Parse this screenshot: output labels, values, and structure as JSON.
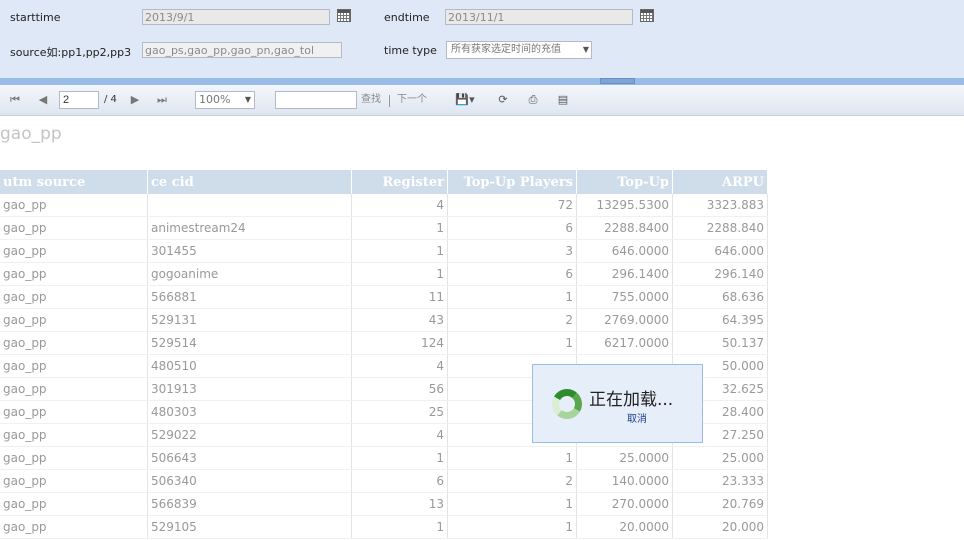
{
  "params": {
    "starttime_label": "starttime",
    "starttime_value": "2013/9/1",
    "endtime_label": "endtime",
    "endtime_value": "2013/11/1",
    "source_label": "source如:pp1,pp2,pp3",
    "source_value": "gao_ps,gao_pp,gao_pn,gao_tol",
    "timetype_label": "time type",
    "timetype_value": "所有获家选定时间的充值"
  },
  "toolbar": {
    "page_value": "2",
    "page_total": "/ 4",
    "zoom_value": "100%",
    "find_label": "查找",
    "next_label": "下一个"
  },
  "report": {
    "title": "gao_pp",
    "columns": [
      "utm source",
      "ce cid",
      "Register",
      "Top-Up Players",
      "Top-Up",
      "ARPU"
    ],
    "rows": [
      [
        "gao_pp",
        "",
        "4",
        "72",
        "13295.5300",
        "3323.883"
      ],
      [
        "gao_pp",
        "animestream24",
        "1",
        "6",
        "2288.8400",
        "2288.840"
      ],
      [
        "gao_pp",
        "301455",
        "1",
        "3",
        "646.0000",
        "646.000"
      ],
      [
        "gao_pp",
        "gogoanime",
        "1",
        "6",
        "296.1400",
        "296.140"
      ],
      [
        "gao_pp",
        "566881",
        "11",
        "1",
        "755.0000",
        "68.636"
      ],
      [
        "gao_pp",
        "529131",
        "43",
        "2",
        "2769.0000",
        "64.395"
      ],
      [
        "gao_pp",
        "529514",
        "124",
        "1",
        "6217.0000",
        "50.137"
      ],
      [
        "gao_pp",
        "480510",
        "4",
        "",
        "",
        "50.000"
      ],
      [
        "gao_pp",
        "301913",
        "56",
        "",
        "",
        "32.625"
      ],
      [
        "gao_pp",
        "480303",
        "25",
        "",
        "",
        "28.400"
      ],
      [
        "gao_pp",
        "529022",
        "4",
        "",
        "",
        "27.250"
      ],
      [
        "gao_pp",
        "506643",
        "1",
        "1",
        "25.0000",
        "25.000"
      ],
      [
        "gao_pp",
        "506340",
        "6",
        "2",
        "140.0000",
        "23.333"
      ],
      [
        "gao_pp",
        "566839",
        "13",
        "1",
        "270.0000",
        "20.769"
      ],
      [
        "gao_pp",
        "529105",
        "1",
        "1",
        "20.0000",
        "20.000"
      ]
    ]
  },
  "loading": {
    "text": "正在加载...",
    "cancel": "取消"
  },
  "colors": {
    "header_bg": "#cfdcea",
    "panel_bg": "#dfe8f6",
    "splitter": "#99bbe8"
  }
}
